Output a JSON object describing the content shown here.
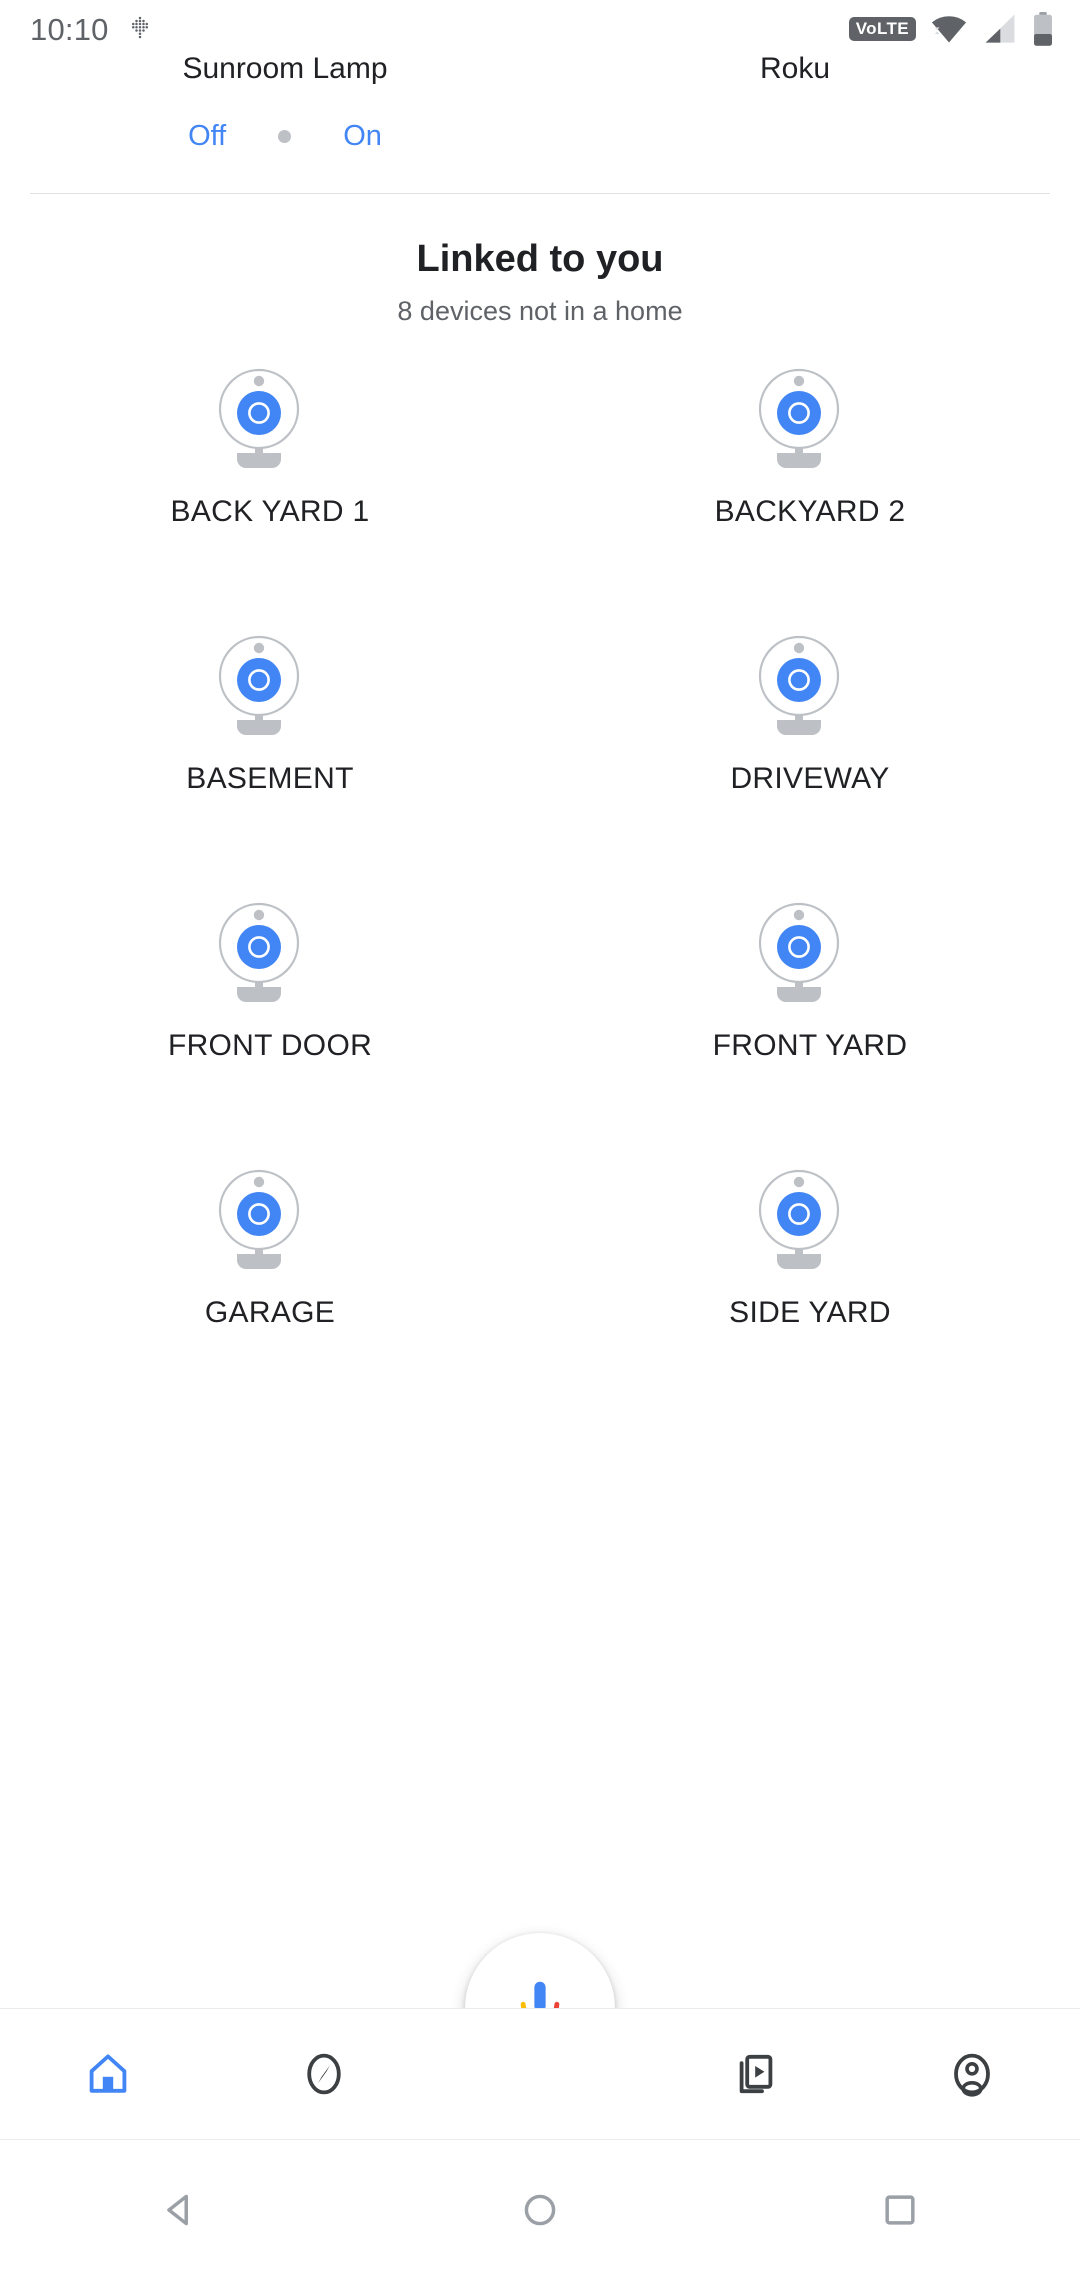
{
  "status_bar": {
    "clock": "10:10",
    "dots_icon": "dots-grid-icon",
    "volte_label": "VoLTE",
    "wifi_icon": "wifi-icon",
    "cell_icon": "cell-signal-icon",
    "battery_icon": "battery-icon",
    "icon_color": "#5f6368"
  },
  "top_devices": [
    {
      "name": "Sunroom Lamp"
    },
    {
      "name": "Roku"
    }
  ],
  "top_toggle": {
    "off_label": "Off",
    "on_label": "On",
    "accent_color": "#4285f4",
    "dot_color": "#bdc1c6"
  },
  "section": {
    "title": "Linked to you",
    "subtitle": "8 devices not in a home"
  },
  "devices": [
    {
      "label": "BACK YARD 1",
      "icon": "camera-icon"
    },
    {
      "label": "BACKYARD 2",
      "icon": "camera-icon"
    },
    {
      "label": "BASEMENT",
      "icon": "camera-icon"
    },
    {
      "label": "DRIVEWAY",
      "icon": "camera-icon"
    },
    {
      "label": "FRONT DOOR",
      "icon": "camera-icon"
    },
    {
      "label": "FRONT YARD",
      "icon": "camera-icon"
    },
    {
      "label": "GARAGE",
      "icon": "camera-icon"
    },
    {
      "label": "SIDE YARD",
      "icon": "camera-icon"
    }
  ],
  "device_icon_colors": {
    "lens": "#4285f4",
    "body_outline": "#bdc1c6",
    "stand": "#bdc1c6",
    "led": "#bdc1c6"
  },
  "assistant_fab": {
    "icon": "google-assistant-mic-icon",
    "mic_blue": "#4285f4",
    "arc_yellow": "#fbbc04",
    "arc_red": "#ea4335",
    "arc_green": "#34a853"
  },
  "bottom_nav": {
    "items": [
      {
        "icon": "home-icon",
        "active": true
      },
      {
        "icon": "compass-explore-icon",
        "active": false
      },
      {
        "icon": "media-cast-icon",
        "active": false
      },
      {
        "icon": "account-circle-icon",
        "active": false
      }
    ],
    "active_color": "#4285f4",
    "inactive_color": "#3c4043"
  },
  "system_nav": {
    "back_icon": "back-triangle-icon",
    "home_icon": "home-circle-icon",
    "recents_icon": "recents-square-icon",
    "color": "#9aa0a6"
  }
}
